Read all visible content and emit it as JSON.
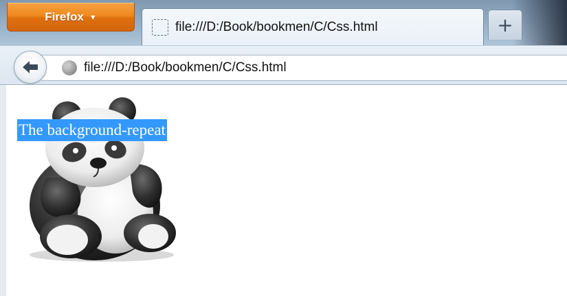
{
  "browser": {
    "menu_button_label": "Firefox",
    "tab_title": "file:///D:/Book/bookmen/C/Css.html",
    "new_tab_label": "+",
    "url": "file:///D:/Book/bookmen/C/Css.html"
  },
  "page": {
    "text": "The background-repeat",
    "image": "panda-image"
  },
  "colors": {
    "menu_button": "#e0700e",
    "selection": "#3399ff"
  },
  "icons": {
    "back": "back-arrow-icon",
    "site": "globe-icon",
    "tab": "blank-page-icon",
    "menu": "chevron-down-icon"
  }
}
